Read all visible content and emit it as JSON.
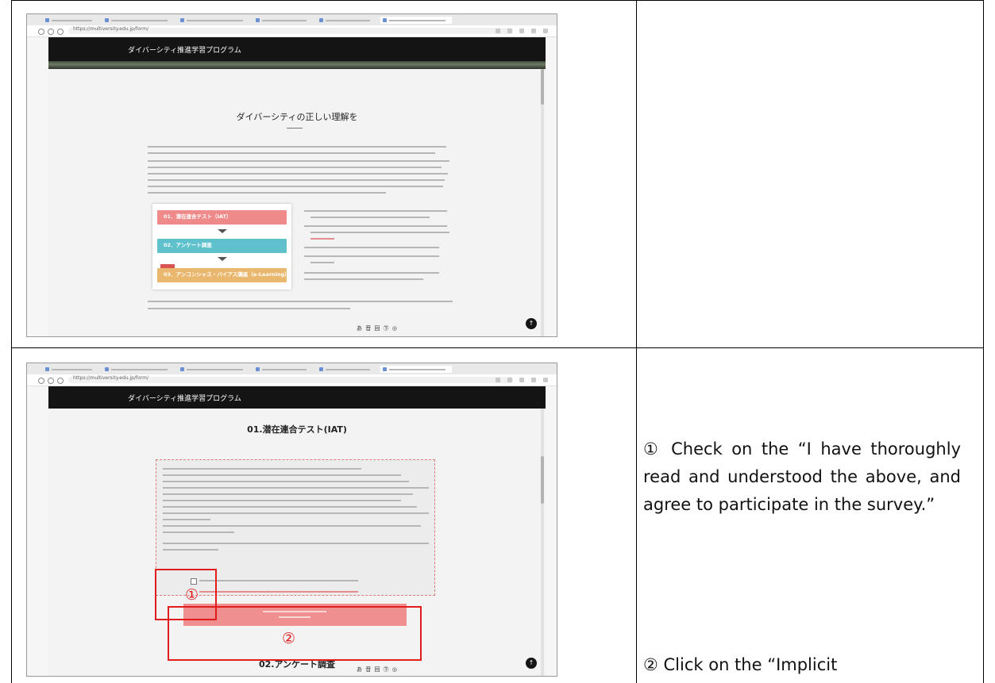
{
  "shot1": {
    "site_title": "ダイバーシティ推進学習プログラム",
    "url": "https://multiversity.edu.jp/form/",
    "heading": "ダイバーシティの正しい理解を",
    "steps": [
      {
        "label": "01．潜在連合テスト（IAT）",
        "color": "#ee8a8a"
      },
      {
        "label": "02．アンケート調査",
        "color": "#5fc1cc"
      },
      {
        "label": "03．アンコンシャス・バイアス講座（e-Learning）",
        "color": "#e9b76d"
      }
    ],
    "accessibility": "あ 音 回 ㊦ ◎",
    "scroll_top_icon": "arrow-up-icon"
  },
  "shot2": {
    "site_title": "ダイバーシティ推進学習プログラム",
    "url": "https://multiversity.edu.jp/form/",
    "heading": "01.潜在連合テスト(IAT)",
    "heading_next": "02.アンケート調査",
    "marker1": "①",
    "marker2": "②",
    "accessibility": "あ 音 回 ㊦ ◎",
    "highlight_color": "#e01c1c"
  },
  "instructions": {
    "step1": "① Check on the “I have thoroughly read and understood the above, and agree to participate in the survey.”",
    "step2": "② Click on the “Implicit"
  }
}
